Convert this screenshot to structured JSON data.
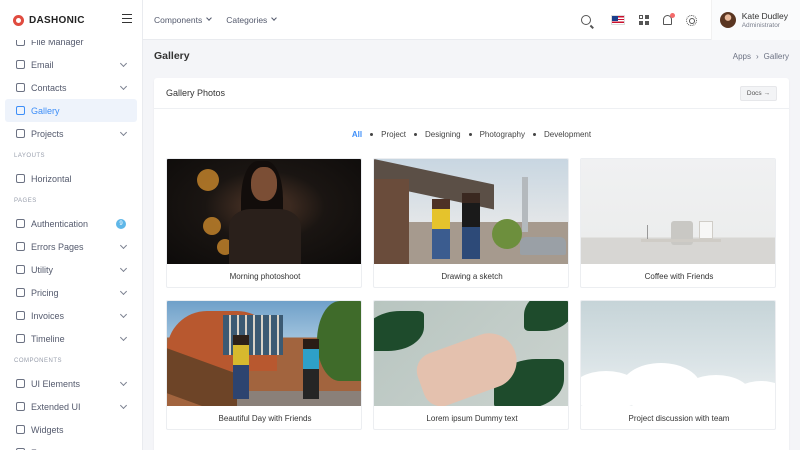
{
  "brand": {
    "name": "DASHONIC"
  },
  "header": {
    "menus": [
      "Components",
      "Categories"
    ],
    "user": {
      "name": "Kate Dudley",
      "role": "Administrator"
    }
  },
  "sidebar": {
    "items": [
      {
        "label": "File Manager",
        "icon": "folder-icon",
        "type": "item"
      },
      {
        "label": "Email",
        "icon": "mail-icon",
        "type": "item",
        "chevron": true
      },
      {
        "label": "Contacts",
        "icon": "contacts-icon",
        "type": "item",
        "chevron": true
      },
      {
        "label": "Gallery",
        "icon": "image-icon",
        "type": "item",
        "active": true
      },
      {
        "label": "Projects",
        "icon": "briefcase-icon",
        "type": "item",
        "chevron": true
      },
      {
        "label": "Layouts",
        "type": "title"
      },
      {
        "label": "Horizontal",
        "icon": "layout-icon",
        "type": "item"
      },
      {
        "label": "Pages",
        "type": "title"
      },
      {
        "label": "Authentication",
        "icon": "user-icon",
        "type": "item",
        "badge": "9"
      },
      {
        "label": "Errors Pages",
        "icon": "alert-icon",
        "type": "item",
        "chevron": true
      },
      {
        "label": "Utility",
        "icon": "file-icon",
        "type": "item",
        "chevron": true
      },
      {
        "label": "Pricing",
        "icon": "tag-icon",
        "type": "item",
        "chevron": true
      },
      {
        "label": "Invoices",
        "icon": "invoice-icon",
        "type": "item",
        "chevron": true
      },
      {
        "label": "Timeline",
        "icon": "clock-icon",
        "type": "item",
        "chevron": true
      },
      {
        "label": "Components",
        "type": "title"
      },
      {
        "label": "UI Elements",
        "icon": "box-icon",
        "type": "item",
        "chevron": true
      },
      {
        "label": "Extended UI",
        "icon": "settings-icon",
        "type": "item",
        "chevron": true
      },
      {
        "label": "Widgets",
        "icon": "grid-icon",
        "type": "item"
      },
      {
        "label": "Forms",
        "icon": "form-icon",
        "type": "item",
        "chevron": true
      }
    ]
  },
  "page": {
    "title": "Gallery",
    "breadcrumb": [
      "Apps",
      "Gallery"
    ]
  },
  "gallery": {
    "title": "Gallery Photos",
    "docs_label": "Docs →",
    "filters": [
      "All",
      "Project",
      "Designing",
      "Photography",
      "Development"
    ],
    "active_filter": "All",
    "photos": [
      {
        "caption": "Morning photoshoot"
      },
      {
        "caption": "Drawing a sketch"
      },
      {
        "caption": "Coffee with Friends"
      },
      {
        "caption": "Beautiful Day with Friends"
      },
      {
        "caption": "Lorem ipsum Dummy text"
      },
      {
        "caption": "Project discussion with team"
      }
    ]
  },
  "colors": {
    "accent": "#3d8ef8",
    "brand": "#e04b3f",
    "badge": "#5fb7e8"
  }
}
